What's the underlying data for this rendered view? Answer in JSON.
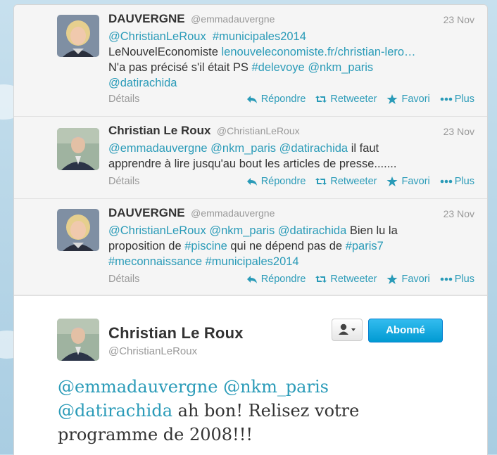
{
  "colors": {
    "link": "#2a9bb8",
    "follow_button": "#019ad2"
  },
  "tweets": [
    {
      "name": "DAUVERGNE",
      "handle": "@emmadauvergne",
      "date": "23 Nov",
      "avatar": "woman-avatar",
      "lines": [
        [
          {
            "t": "@ChristianLeRoux",
            "link": true
          },
          {
            "t": "  ",
            "link": false
          },
          {
            "t": "#municipales2014",
            "link": true
          }
        ],
        [
          {
            "t": "LeNouvelEconomiste ",
            "link": false
          },
          {
            "t": "lenouveleconomiste.fr/christian-lero…",
            "link": true
          }
        ],
        [
          {
            "t": "N'a pas précisé s'il était PS ",
            "link": false
          },
          {
            "t": "#delevoye",
            "link": true
          },
          {
            "t": " ",
            "link": false
          },
          {
            "t": "@nkm_paris",
            "link": true
          }
        ],
        [
          {
            "t": "@datirachida",
            "link": true
          }
        ]
      ],
      "details": "Détails",
      "actions": {
        "reply": "Répondre",
        "retweet": "Retweeter",
        "favorite": "Favori",
        "more": "Plus"
      }
    },
    {
      "name": "Christian Le Roux",
      "handle": "@ChristianLeRoux",
      "date": "23 Nov",
      "avatar": "man-avatar",
      "lines": [
        [
          {
            "t": "@emmadauvergne",
            "link": true
          },
          {
            "t": " ",
            "link": false
          },
          {
            "t": "@nkm_paris",
            "link": true
          },
          {
            "t": " ",
            "link": false
          },
          {
            "t": "@datirachida",
            "link": true
          },
          {
            "t": " il faut",
            "link": false
          }
        ],
        [
          {
            "t": "apprendre à lire jusqu'au bout les articles de presse.......",
            "link": false
          }
        ]
      ],
      "details": "Détails",
      "actions": {
        "reply": "Répondre",
        "retweet": "Retweeter",
        "favorite": "Favori",
        "more": "Plus"
      }
    },
    {
      "name": "DAUVERGNE",
      "handle": "@emmadauvergne",
      "date": "23 Nov",
      "avatar": "woman-avatar",
      "lines": [
        [
          {
            "t": "@ChristianLeRoux",
            "link": true
          },
          {
            "t": " ",
            "link": false
          },
          {
            "t": "@nkm_paris",
            "link": true
          },
          {
            "t": " ",
            "link": false
          },
          {
            "t": "@datirachida",
            "link": true
          },
          {
            "t": " Bien lu la",
            "link": false
          }
        ],
        [
          {
            "t": "proposition de ",
            "link": false
          },
          {
            "t": "#piscine",
            "link": true
          },
          {
            "t": " qui ne dépend pas de ",
            "link": false
          },
          {
            "t": "#paris7",
            "link": true
          }
        ],
        [
          {
            "t": "#meconnaissance",
            "link": true
          },
          {
            "t": " ",
            "link": false
          },
          {
            "t": "#municipales2014",
            "link": true
          }
        ]
      ],
      "details": "Détails",
      "actions": {
        "reply": "Répondre",
        "retweet": "Retweeter",
        "favorite": "Favori",
        "more": "Plus"
      }
    }
  ],
  "main_tweet": {
    "name": "Christian Le Roux",
    "handle": "@ChristianLeRoux",
    "follow_label": "Abonné",
    "avatar": "man-avatar",
    "lines": [
      [
        {
          "t": "@emmadauvergne",
          "link": true
        },
        {
          "t": " ",
          "link": false
        },
        {
          "t": "@nkm_paris",
          "link": true
        }
      ],
      [
        {
          "t": "@datirachida",
          "link": true
        },
        {
          "t": " ah bon! Relisez votre",
          "link": false
        }
      ],
      [
        {
          "t": "programme de 2008!!!",
          "link": false
        }
      ]
    ]
  }
}
